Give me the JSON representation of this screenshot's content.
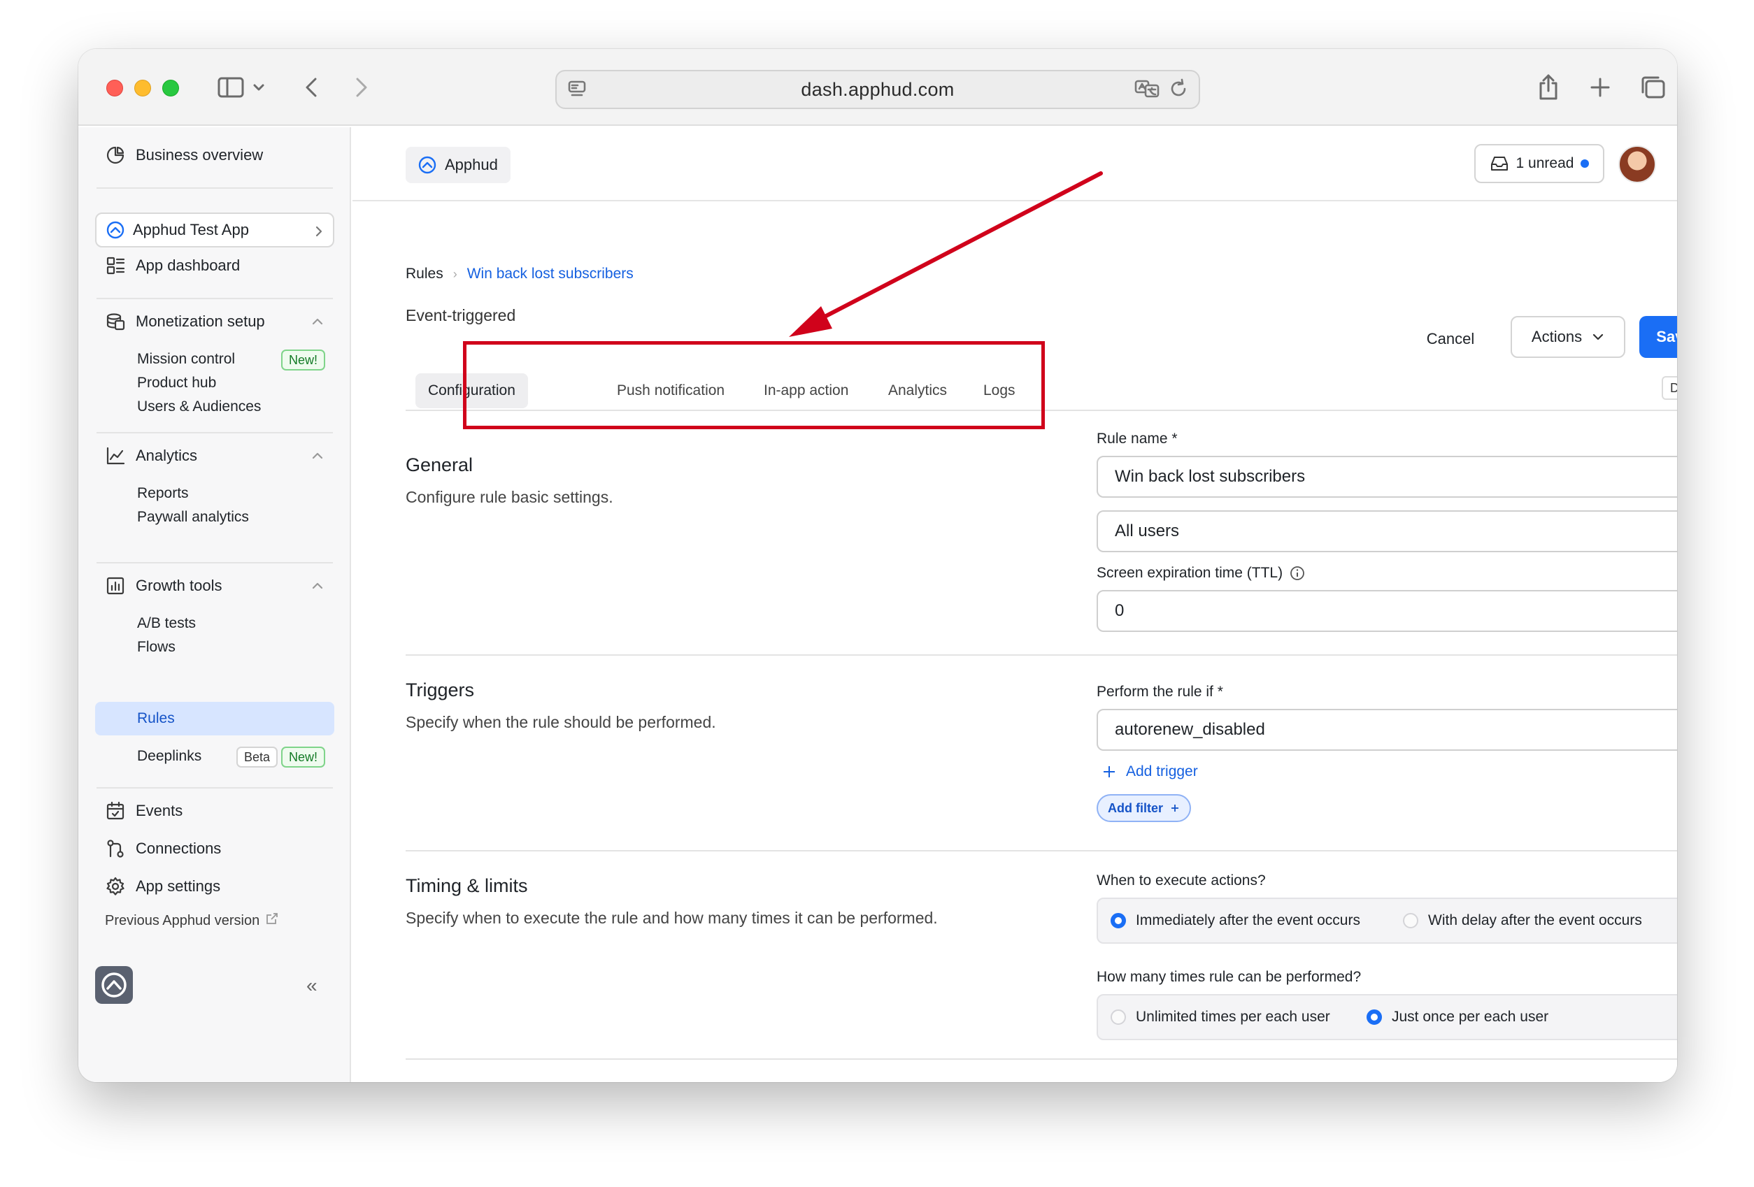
{
  "browser": {
    "url": "dash.apphud.com"
  },
  "sidebar": {
    "business_overview": "Business overview",
    "app_selector": "Apphud Test App",
    "app_dashboard": "App dashboard",
    "monetization": {
      "label": "Monetization setup",
      "items": [
        {
          "label": "Mission control",
          "badge": "New!"
        },
        {
          "label": "Product hub"
        },
        {
          "label": "Users & Audiences"
        }
      ]
    },
    "analytics": {
      "label": "Analytics",
      "items": [
        {
          "label": "Reports"
        },
        {
          "label": "Paywall analytics"
        }
      ]
    },
    "growth": {
      "label": "Growth tools",
      "items": [
        {
          "label": "A/B tests"
        },
        {
          "label": "Flows"
        },
        {
          "label": "Rules",
          "active": true
        },
        {
          "label": "Deeplinks",
          "badge_beta": "Beta",
          "badge_new": "New!"
        }
      ]
    },
    "events": "Events",
    "connections": "Connections",
    "app_settings": "App settings",
    "previous_version": "Previous Apphud version",
    "collapse_glyph": "«"
  },
  "topbar": {
    "org_name": "Apphud",
    "unread_label": "1 unread"
  },
  "page": {
    "breadcrumb_root": "Rules",
    "breadcrumb_current": "Win back lost subscribers",
    "subtitle": "Event-triggered",
    "cancel_label": "Cancel",
    "actions_label": "Actions",
    "save_label": "Save",
    "status_badge": "Draft",
    "tabs": [
      {
        "label": "Configuration",
        "active": true
      },
      {
        "label": "Push notification"
      },
      {
        "label": "In-app action"
      },
      {
        "label": "Analytics"
      },
      {
        "label": "Logs"
      }
    ]
  },
  "general": {
    "title": "General",
    "description": "Configure rule basic settings.",
    "rule_name_label": "Rule name *",
    "rule_name_value": "Win back lost subscribers",
    "audience_value": "All users",
    "ttl_label": "Screen expiration time (TTL)",
    "ttl_value": "0"
  },
  "triggers": {
    "title": "Triggers",
    "description": "Specify when the rule should be performed.",
    "perform_label": "Perform the rule if *",
    "perform_value": "autorenew_disabled",
    "add_trigger_label": "Add trigger",
    "add_filter_label": "Add filter"
  },
  "timing": {
    "title": "Timing & limits",
    "description": "Specify when to execute the rule and how many times it can be performed.",
    "execute_label": "When to execute actions?",
    "execute_options": [
      {
        "label": "Immediately after the event occurs",
        "selected": true
      },
      {
        "label": "With delay after the event occurs",
        "selected": false
      }
    ],
    "times_label": "How many times rule can be performed?",
    "times_options": [
      {
        "label": "Unlimited times per each user",
        "selected": false
      },
      {
        "label": "Just once per each user",
        "selected": true
      }
    ]
  },
  "colors": {
    "accent": "#1a6ef5",
    "annotation": "#d0021b",
    "active_nav_bg": "#d7e5ff"
  },
  "icons": {
    "annotation_arrow": "arrow-pointing-to-tabs",
    "annotation_box": "highlight-rectangle"
  }
}
